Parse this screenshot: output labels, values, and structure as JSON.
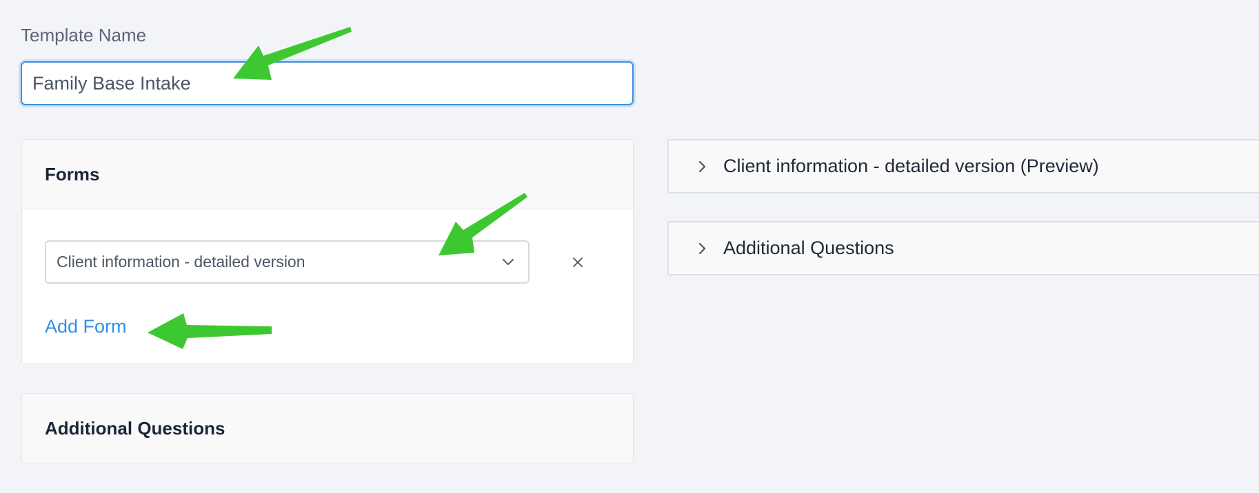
{
  "template": {
    "label": "Template Name",
    "value": "Family Base Intake"
  },
  "forms_card": {
    "title": "Forms",
    "selected_form": "Client information - detailed version",
    "add_form_label": "Add Form",
    "icons": {
      "dropdown": "chevron-down-icon",
      "remove": "close-icon"
    }
  },
  "additional_card": {
    "title": "Additional Questions"
  },
  "preview_panels": [
    {
      "title": "Client information - detailed version (Preview)",
      "icon": "chevron-right-icon"
    },
    {
      "title": "Additional Questions",
      "icon": "chevron-right-icon"
    }
  ],
  "colors": {
    "accent": "#2f8fe8",
    "input_focus": "#3b8fe0",
    "annotation_arrow": "#3dc832",
    "background": "#f3f4f7"
  }
}
